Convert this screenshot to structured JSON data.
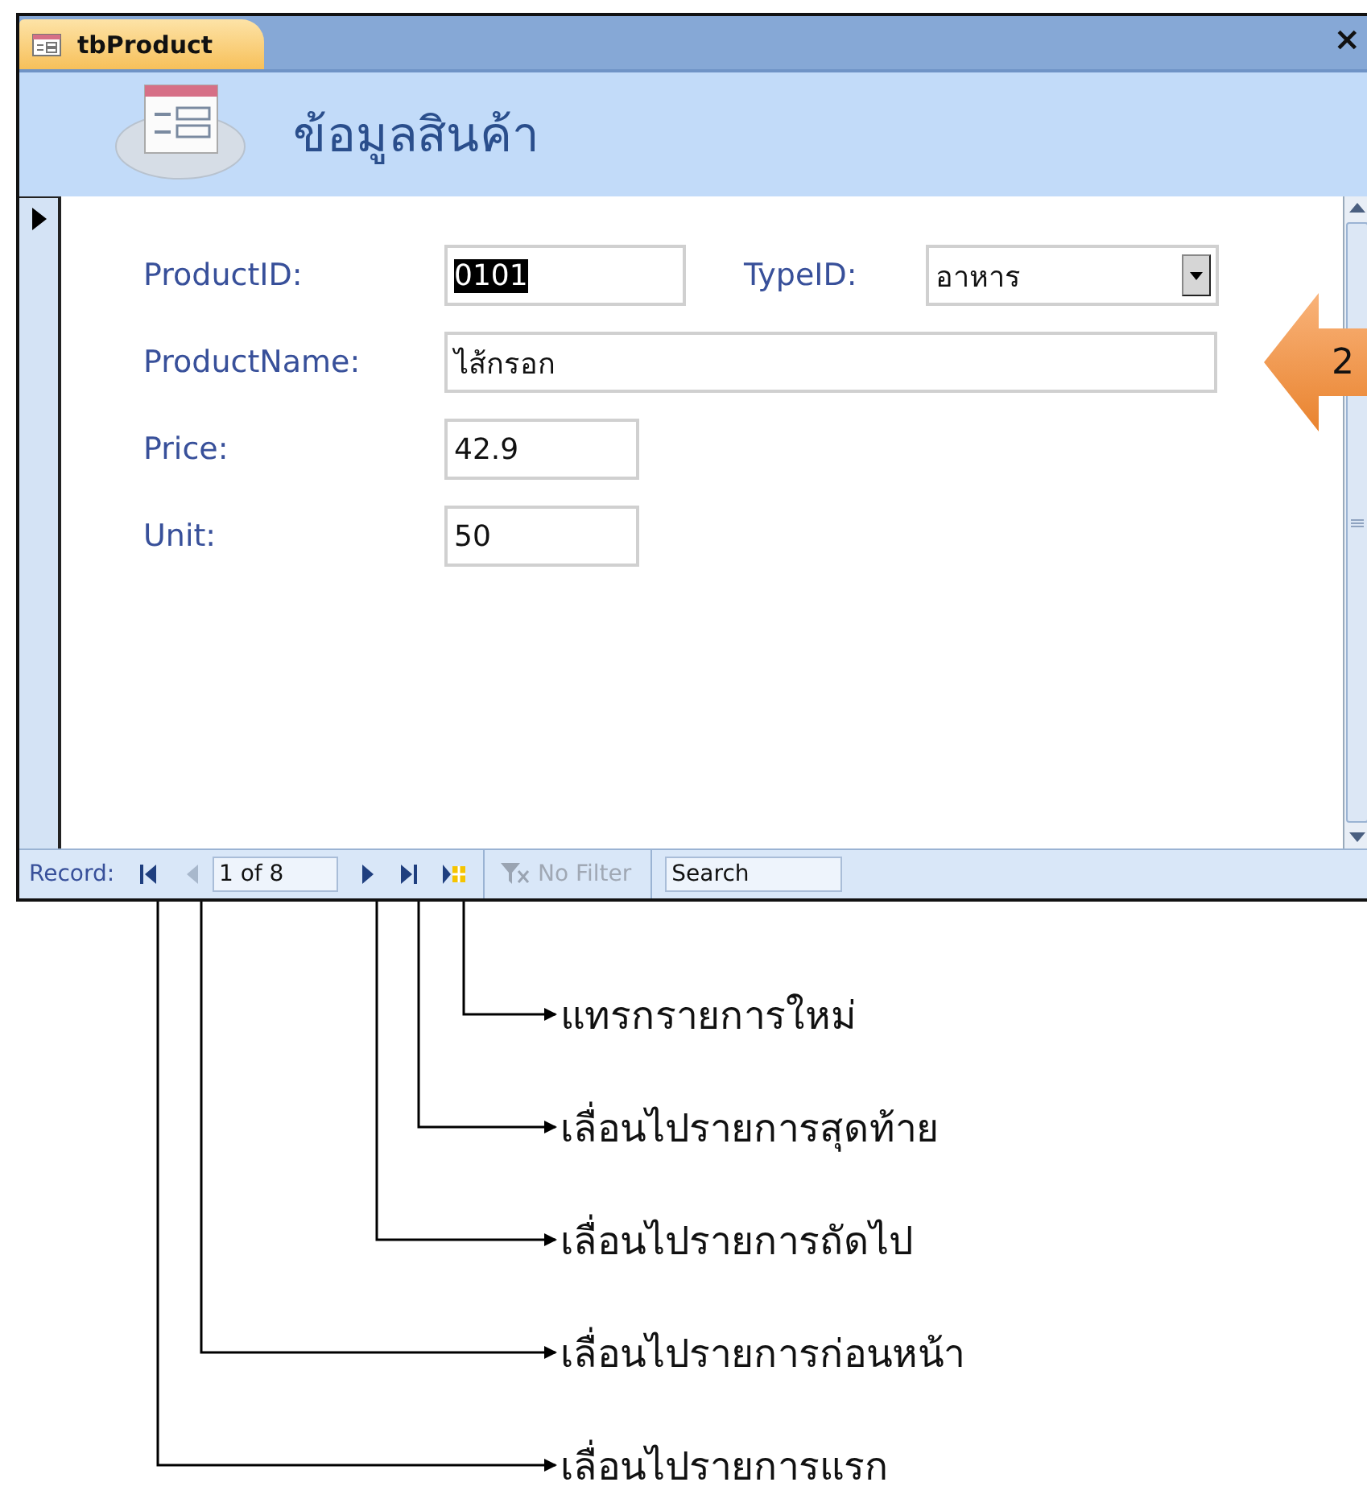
{
  "tab": {
    "title": "tbProduct",
    "close": "×"
  },
  "form_title": "ข้อมูลสินค้า",
  "rows": [
    {
      "fields": [
        {
          "kind": "text",
          "label": "ProductID:",
          "value": "0101",
          "selected": true
        },
        {
          "kind": "combo",
          "label": "TypeID:",
          "value": "อาหาร",
          "selected": false
        }
      ]
    },
    {
      "fields": [
        {
          "kind": "text",
          "label": "ProductName:",
          "value": "ไส้กรอก",
          "selected": false
        }
      ]
    },
    {
      "fields": [
        {
          "kind": "text",
          "label": "Price:",
          "value": "42.9",
          "selected": false
        }
      ]
    },
    {
      "fields": [
        {
          "kind": "text",
          "label": "Unit:",
          "value": "50",
          "selected": false
        }
      ]
    }
  ],
  "step_badge": "2",
  "status_bar": {
    "record_label": "Record:",
    "position": "1 of 8",
    "filter": "No Filter",
    "filter_disabled": true,
    "search_placeholder": "Search",
    "nav": [
      {
        "kind": "first",
        "disabled": false
      },
      {
        "kind": "prev",
        "disabled": true
      },
      {
        "kind": "next",
        "disabled": false
      },
      {
        "kind": "last",
        "disabled": false
      },
      {
        "kind": "new",
        "disabled": false
      }
    ]
  },
  "callouts": [
    {
      "text": "แทรกรายการใหม่"
    },
    {
      "text": "เลื่อนไปรายการสุดท้าย"
    },
    {
      "text": "เลื่อนไปรายการถัดไป"
    },
    {
      "text": "เลื่อนไปรายการก่อนหน้า"
    },
    {
      "text": "เลื่อนไปรายการแรก"
    }
  ]
}
